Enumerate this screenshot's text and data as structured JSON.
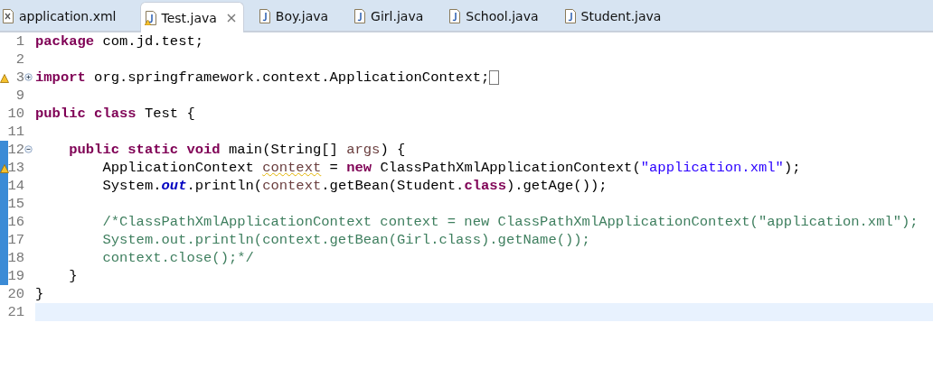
{
  "tabs": [
    {
      "label": "application.xml",
      "kind": "xml",
      "selected": false,
      "warning": false
    },
    {
      "label": "Test.java",
      "kind": "java",
      "selected": true,
      "warning": true
    },
    {
      "label": "Boy.java",
      "kind": "java",
      "selected": false,
      "warning": false
    },
    {
      "label": "Girl.java",
      "kind": "java",
      "selected": false,
      "warning": false
    },
    {
      "label": "School.java",
      "kind": "java",
      "selected": false,
      "warning": false
    },
    {
      "label": "Student.java",
      "kind": "java",
      "selected": false,
      "warning": false
    }
  ],
  "lines": [
    {
      "number": "1",
      "warning": false,
      "changed": false,
      "current": false,
      "tokens": [
        {
          "kind": "kw",
          "text": "package"
        },
        {
          "kind": "plain",
          "text": " com.jd.test;"
        }
      ]
    },
    {
      "number": "2",
      "warning": false,
      "changed": false,
      "current": false
    },
    {
      "number": "3",
      "warning": true,
      "changed": false,
      "current": false,
      "fold": {
        "expanded": false
      },
      "tokens": [
        {
          "kind": "kw",
          "text": "import"
        },
        {
          "kind": "plain",
          "text": " org.springframework.context.ApplicationContext;"
        }
      ]
    },
    {
      "number": "9",
      "warning": false,
      "changed": false,
      "current": false
    },
    {
      "number": "10",
      "warning": false,
      "changed": false,
      "current": false,
      "tokens": [
        {
          "kind": "kw",
          "text": "public class"
        },
        {
          "kind": "plain",
          "text": " Test {"
        }
      ],
      "children": [
        {
          "number": "11",
          "warning": false,
          "changed": false,
          "current": false
        },
        {
          "number": "12",
          "warning": false,
          "changed": true,
          "current": false,
          "fold": {
            "expanded": true
          },
          "tokens": [
            {
              "kind": "kw",
              "text": "public static void"
            },
            {
              "kind": "plain",
              "text": " main(String[] "
            },
            {
              "kind": "param",
              "text": "args"
            },
            {
              "kind": "plain",
              "text": ") {"
            }
          ],
          "children": [
            {
              "number": "13",
              "warning": true,
              "changed": true,
              "current": false,
              "tokens": [
                {
                  "kind": "plain",
                  "text": "ApplicationContext "
                },
                {
                  "kind": "local-warn",
                  "text": "context"
                },
                {
                  "kind": "plain",
                  "text": " = "
                },
                {
                  "kind": "kw",
                  "text": "new"
                },
                {
                  "kind": "plain",
                  "text": " ClassPathXmlApplicationContext("
                },
                {
                  "kind": "str",
                  "text": "\"application.xml\""
                },
                {
                  "kind": "plain",
                  "text": ");"
                }
              ]
            },
            {
              "number": "14",
              "warning": false,
              "changed": true,
              "current": false,
              "tokens": [
                {
                  "kind": "plain",
                  "text": "System."
                },
                {
                  "kind": "field",
                  "text": "out"
                },
                {
                  "kind": "plain",
                  "text": ".println("
                },
                {
                  "kind": "local",
                  "text": "context"
                },
                {
                  "kind": "plain",
                  "text": ".getBean(Student."
                },
                {
                  "kind": "kw",
                  "text": "class"
                },
                {
                  "kind": "plain",
                  "text": ").getAge());"
                }
              ]
            },
            {
              "number": "15",
              "warning": false,
              "changed": true,
              "current": false
            },
            {
              "number": "16",
              "warning": false,
              "changed": true,
              "current": false,
              "tokens": [
                {
                  "kind": "comment",
                  "text": "/*ClassPathXmlApplicationContext context = new ClassPathXmlApplicationContext(\"application.xml\");"
                }
              ]
            },
            {
              "number": "17",
              "warning": false,
              "changed": true,
              "current": false,
              "tokens": [
                {
                  "kind": "comment",
                  "text": "System.out.println(context.getBean(Girl.class).getName());"
                }
              ]
            },
            {
              "number": "18",
              "warning": false,
              "changed": true,
              "current": false,
              "tokens": [
                {
                  "kind": "comment",
                  "text": "context.close();*/"
                }
              ]
            }
          ]
        },
        {
          "number": "19",
          "warning": false,
          "changed": true,
          "current": false,
          "tokens": [
            {
              "kind": "plain",
              "text": "}"
            }
          ]
        }
      ]
    },
    {
      "number": "20",
      "warning": false,
      "changed": false,
      "current": false,
      "tokens": [
        {
          "kind": "plain",
          "text": "}"
        }
      ]
    },
    {
      "number": "21",
      "warning": false,
      "changed": false,
      "current": true
    }
  ]
}
